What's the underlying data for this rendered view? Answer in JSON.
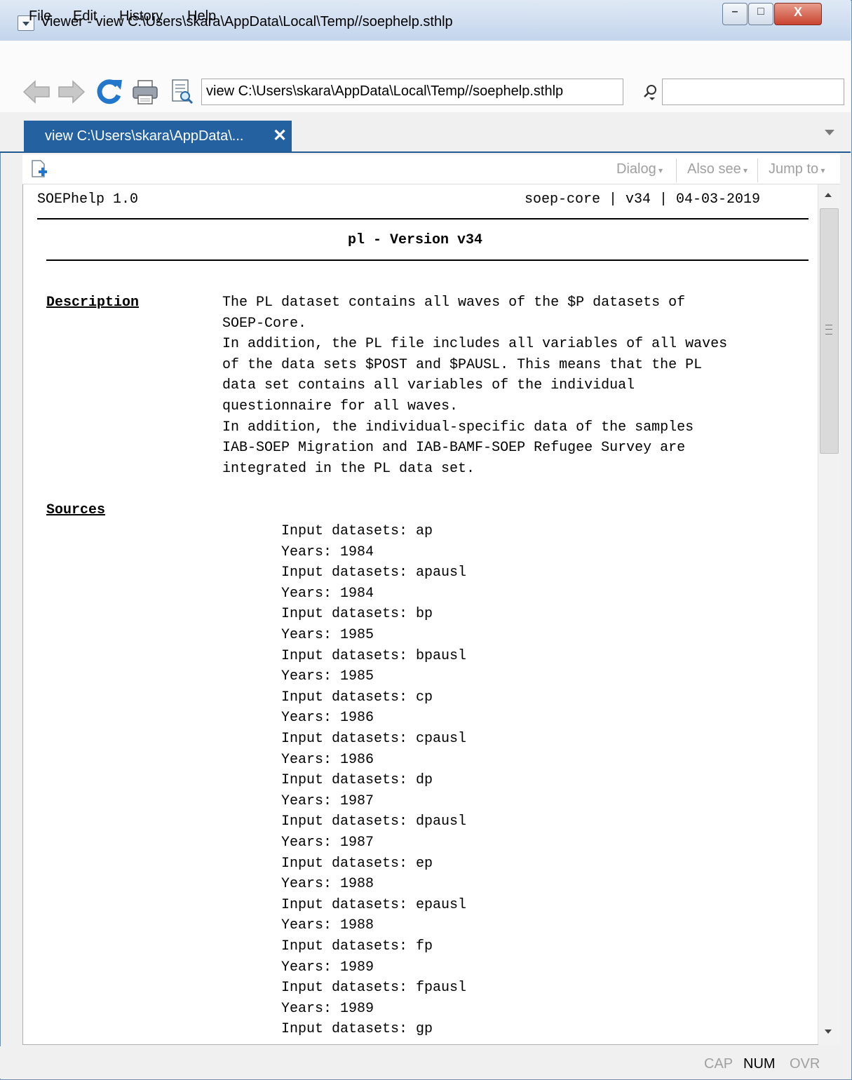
{
  "window": {
    "title": "Viewer - view C:\\Users\\skara\\AppData\\Local\\Temp//soephelp.sthlp",
    "min_glyph": "–",
    "max_glyph": "□",
    "close_glyph": "X"
  },
  "menu": [
    "File",
    "Edit",
    "History",
    "Help"
  ],
  "toolbar": {
    "address": "view C:\\Users\\skara\\AppData\\Local\\Temp//soephelp.sthlp",
    "search_value": ""
  },
  "tab": {
    "label": "view C:\\Users\\skara\\AppData\\...",
    "close": "✕"
  },
  "doc_toolbar": {
    "dialog": "Dialog",
    "also_see": "Also see",
    "jump_to": "Jump to"
  },
  "help": {
    "product": "SOEPhelp 1.0",
    "meta": "soep-core | v34 | 04-03-2019",
    "title": "pl - Version v34",
    "description_heading": "Description",
    "description_lines": [
      "The PL dataset contains all waves of the $P datasets of",
      "SOEP-Core.",
      "In addition, the PL file includes all variables of all waves",
      "of the data sets $POST and $PAUSL. This means that the PL",
      "data set contains all variables of the individual",
      "questionnaire for all waves.",
      "In addition, the individual-specific data of the samples",
      "IAB-SOEP Migration and IAB-BAMF-SOEP Refugee Survey are",
      "integrated in the PL data set."
    ],
    "sources_heading": "Sources",
    "sources_lines": [
      "Input datasets: ap",
      "Years: 1984",
      "Input datasets: apausl",
      "Years: 1984",
      "Input datasets: bp",
      "Years: 1985",
      "Input datasets: bpausl",
      "Years: 1985",
      "Input datasets: cp",
      "Years: 1986",
      "Input datasets: cpausl",
      "Years: 1986",
      "Input datasets: dp",
      "Years: 1987",
      "Input datasets: dpausl",
      "Years: 1987",
      "Input datasets: ep",
      "Years: 1988",
      "Input datasets: epausl",
      "Years: 1988",
      "Input datasets: fp",
      "Years: 1989",
      "Input datasets: fpausl",
      "Years: 1989",
      "Input datasets: gp"
    ]
  },
  "status": {
    "cap": "CAP",
    "num": "NUM",
    "ovr": "OVR"
  },
  "colors": {
    "tab_active": "#2461a0",
    "refresh_icon": "#2277cc",
    "disabled_text": "#a0a0a0"
  }
}
